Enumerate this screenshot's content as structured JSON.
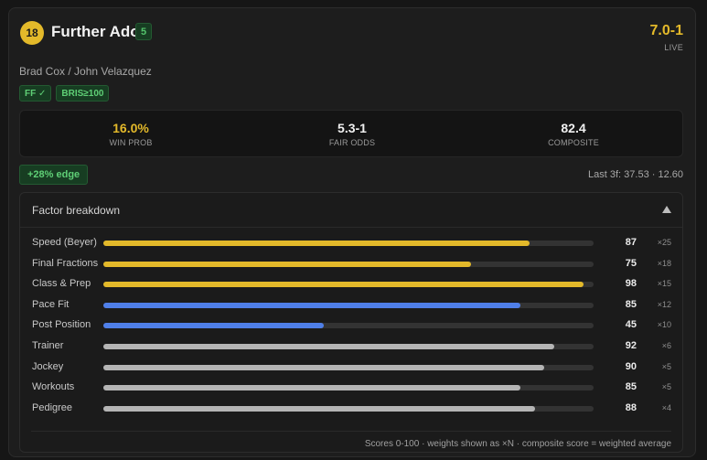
{
  "horse": {
    "post": "18",
    "name": "Further Ado",
    "morning_line_badge": "5",
    "odds": "7.0-1",
    "odds_label": "LIVE",
    "connections": "Brad Cox / John Velazquez",
    "tags": [
      "FF ✓",
      "BRIS≥100"
    ]
  },
  "stats": [
    {
      "value": "16.0%",
      "label": "WIN PROB",
      "highlight": true
    },
    {
      "value": "5.3-1",
      "label": "FAIR ODDS",
      "highlight": false
    },
    {
      "value": "82.4",
      "label": "COMPOSITE",
      "highlight": false
    }
  ],
  "edge": "+28% edge",
  "last3f": "Last 3f: 37.53 · 12.60",
  "factors": {
    "title": "Factor breakdown",
    "rows": [
      {
        "label": "Speed (Beyer)",
        "score": 87,
        "weight": "×25",
        "color": "#e3b92a"
      },
      {
        "label": "Final Fractions",
        "score": 75,
        "weight": "×18",
        "color": "#e3b92a"
      },
      {
        "label": "Class & Prep",
        "score": 98,
        "weight": "×15",
        "color": "#e3b92a"
      },
      {
        "label": "Pace Fit",
        "score": 85,
        "weight": "×12",
        "color": "#4f7fe8"
      },
      {
        "label": "Post Position",
        "score": 45,
        "weight": "×10",
        "color": "#4f7fe8"
      },
      {
        "label": "Trainer",
        "score": 92,
        "weight": "×6",
        "color": "#b5b5b5"
      },
      {
        "label": "Jockey",
        "score": 90,
        "weight": "×5",
        "color": "#b5b5b5"
      },
      {
        "label": "Workouts",
        "score": 85,
        "weight": "×5",
        "color": "#b5b5b5"
      },
      {
        "label": "Pedigree",
        "score": 88,
        "weight": "×4",
        "color": "#b5b5b5"
      }
    ],
    "footer": "Scores 0-100 · weights shown as ×N · composite score = weighted average"
  },
  "icons": {
    "collapse": "chevron-up-icon"
  }
}
